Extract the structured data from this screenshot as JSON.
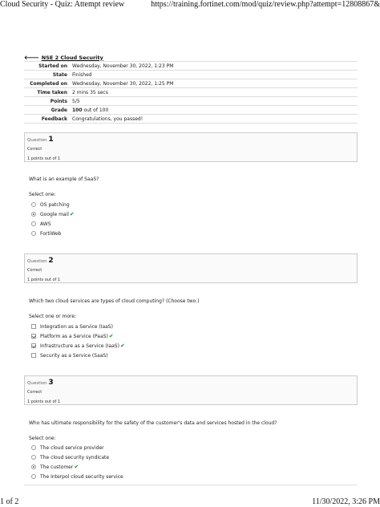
{
  "print_header": {
    "title": "Cloud Security - Quiz: Attempt review",
    "url": "https://training.fortinet.com/mod/quiz/review.php?attempt=12808867&"
  },
  "print_footer": {
    "page": "1 of 2",
    "datetime": "11/30/2022, 3:26 PM"
  },
  "back_link": {
    "icon": "arrow-left-icon",
    "label": "NSE 2 Cloud Security"
  },
  "summary": {
    "started_label": "Started on",
    "started_value": "Wednesday, November 30, 2022, 1:23 PM",
    "state_label": "State",
    "state_value": "Finished",
    "completed_label": "Completed on",
    "completed_value": "Wednesday, November 30, 2022, 1:25 PM",
    "time_label": "Time taken",
    "time_value": "2 mins 35 secs",
    "points_label": "Points",
    "points_value": "5/5",
    "grade_label": "Grade",
    "grade_score": "100",
    "grade_rest": " out of 100",
    "feedback_label": "Feedback",
    "feedback_value": "Congratulations, you passed!"
  },
  "questions": [
    {
      "label": "Question",
      "number": "1",
      "state": "Correct",
      "grade": "1 points out of 1",
      "text": "What is an example of SaaS?",
      "prompt": "Select one:",
      "answers": [
        {
          "text": "OS patching",
          "selected": false,
          "correct": false
        },
        {
          "text": "Google mail",
          "selected": true,
          "correct": true
        },
        {
          "text": "AWS",
          "selected": false,
          "correct": false
        },
        {
          "text": "FortiWeb",
          "selected": false,
          "correct": false
        }
      ]
    },
    {
      "label": "Question",
      "number": "2",
      "state": "Correct",
      "grade": "1 points out of 1",
      "text": "Which two cloud services are types of cloud computing? (Choose two.)",
      "prompt": "Select one or more:",
      "answers": [
        {
          "text": "Integration as a Service (IaaS)",
          "selected": false,
          "correct": false
        },
        {
          "text": "Platform as a Service (PaaS)",
          "selected": true,
          "correct": true
        },
        {
          "text": "Infrastructure as a Service (IaaS)",
          "selected": true,
          "correct": true
        },
        {
          "text": "Security as a Service (SaaS)",
          "selected": false,
          "correct": false
        }
      ]
    },
    {
      "label": "Question",
      "number": "3",
      "state": "Correct",
      "grade": "1 points out of 1",
      "text": "Who has ultimate responsibility for the safety of the customer's data and services hosted in the cloud?",
      "prompt": "Select one:",
      "answers": [
        {
          "text": "The cloud service provider",
          "selected": false,
          "correct": false
        },
        {
          "text": "The cloud security syndicate",
          "selected": false,
          "correct": false
        },
        {
          "text": "The customer",
          "selected": true,
          "correct": true
        },
        {
          "text": "The Interpol cloud security service",
          "selected": false,
          "correct": false
        }
      ]
    }
  ],
  "icons": {
    "correct": "check-icon",
    "tick_glyph": "✔"
  }
}
